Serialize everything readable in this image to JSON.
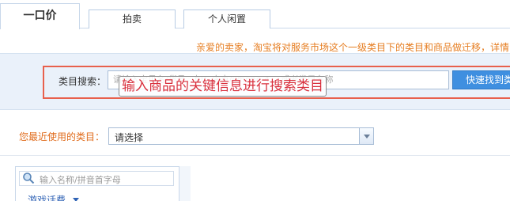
{
  "tabs": [
    {
      "label": "一口价",
      "active": true
    },
    {
      "label": "拍卖",
      "active": false
    },
    {
      "label": "个人闲置",
      "active": false
    }
  ],
  "notice": "亲爱的卖家，淘宝将对服务市场这个一级类目下的类目和商品做迁移，详情",
  "search": {
    "label": "类目搜索：",
    "placeholder": "请输入宝贝名/货号，如：夹克/iPhone 4 ，或者类目名称",
    "overlay_caption": "输入商品的关键信息进行搜索类目",
    "button_label": "快速找到类目"
  },
  "recent": {
    "label": "您最近使用的类目：",
    "selected": "请选择"
  },
  "category_panel": {
    "search_placeholder": "输入名称/拼音首字母",
    "first_item": "游戏话费"
  },
  "colors": {
    "accent": "#3f8fe0",
    "notice": "#e67e22",
    "highlight_frame": "#e8604c",
    "overlay_text": "#d9303d"
  }
}
